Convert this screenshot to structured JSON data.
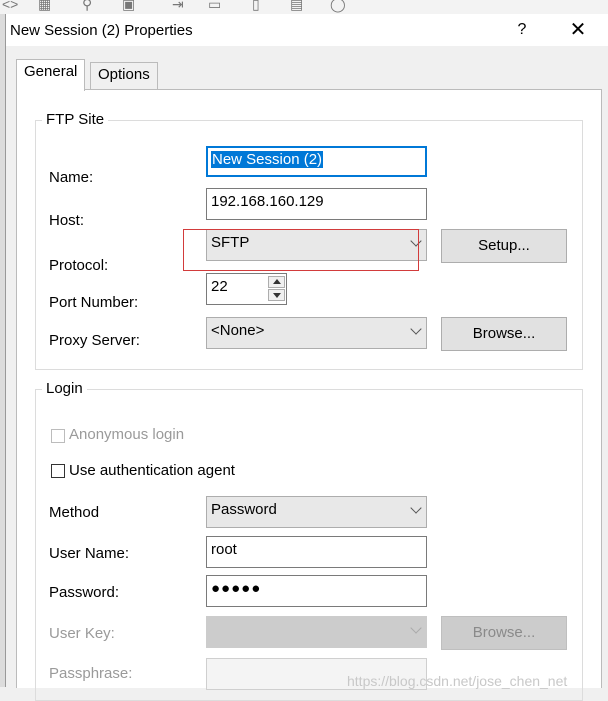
{
  "dialog": {
    "title": "New Session (2) Properties",
    "help_label": "?",
    "close_label": "✕"
  },
  "tabs": [
    {
      "label": "General",
      "active": true
    },
    {
      "label": "Options",
      "active": false
    }
  ],
  "ftp_site": {
    "legend": "FTP Site",
    "name_label": "Name:",
    "name_value": "New Session (2)",
    "host_label": "Host:",
    "host_value": "192.168.160.129",
    "protocol_label": "Protocol:",
    "protocol_value": "SFTP",
    "setup_button": "Setup...",
    "port_label": "Port Number:",
    "port_value": "22",
    "proxy_label": "Proxy Server:",
    "proxy_value": "<None>",
    "browse_button": "Browse..."
  },
  "login": {
    "legend": "Login",
    "anonymous_label": "Anonymous login",
    "auth_agent_label": "Use authentication agent",
    "method_label": "Method",
    "method_value": "Password",
    "username_label": "User Name:",
    "username_value": "root",
    "password_label": "Password:",
    "password_value": "●●●●●",
    "userkey_label": "User Key:",
    "userkey_browse_button": "Browse...",
    "passphrase_label": "Passphrase:"
  },
  "watermark": "https://blog.csdn.net/jose_chen_net"
}
